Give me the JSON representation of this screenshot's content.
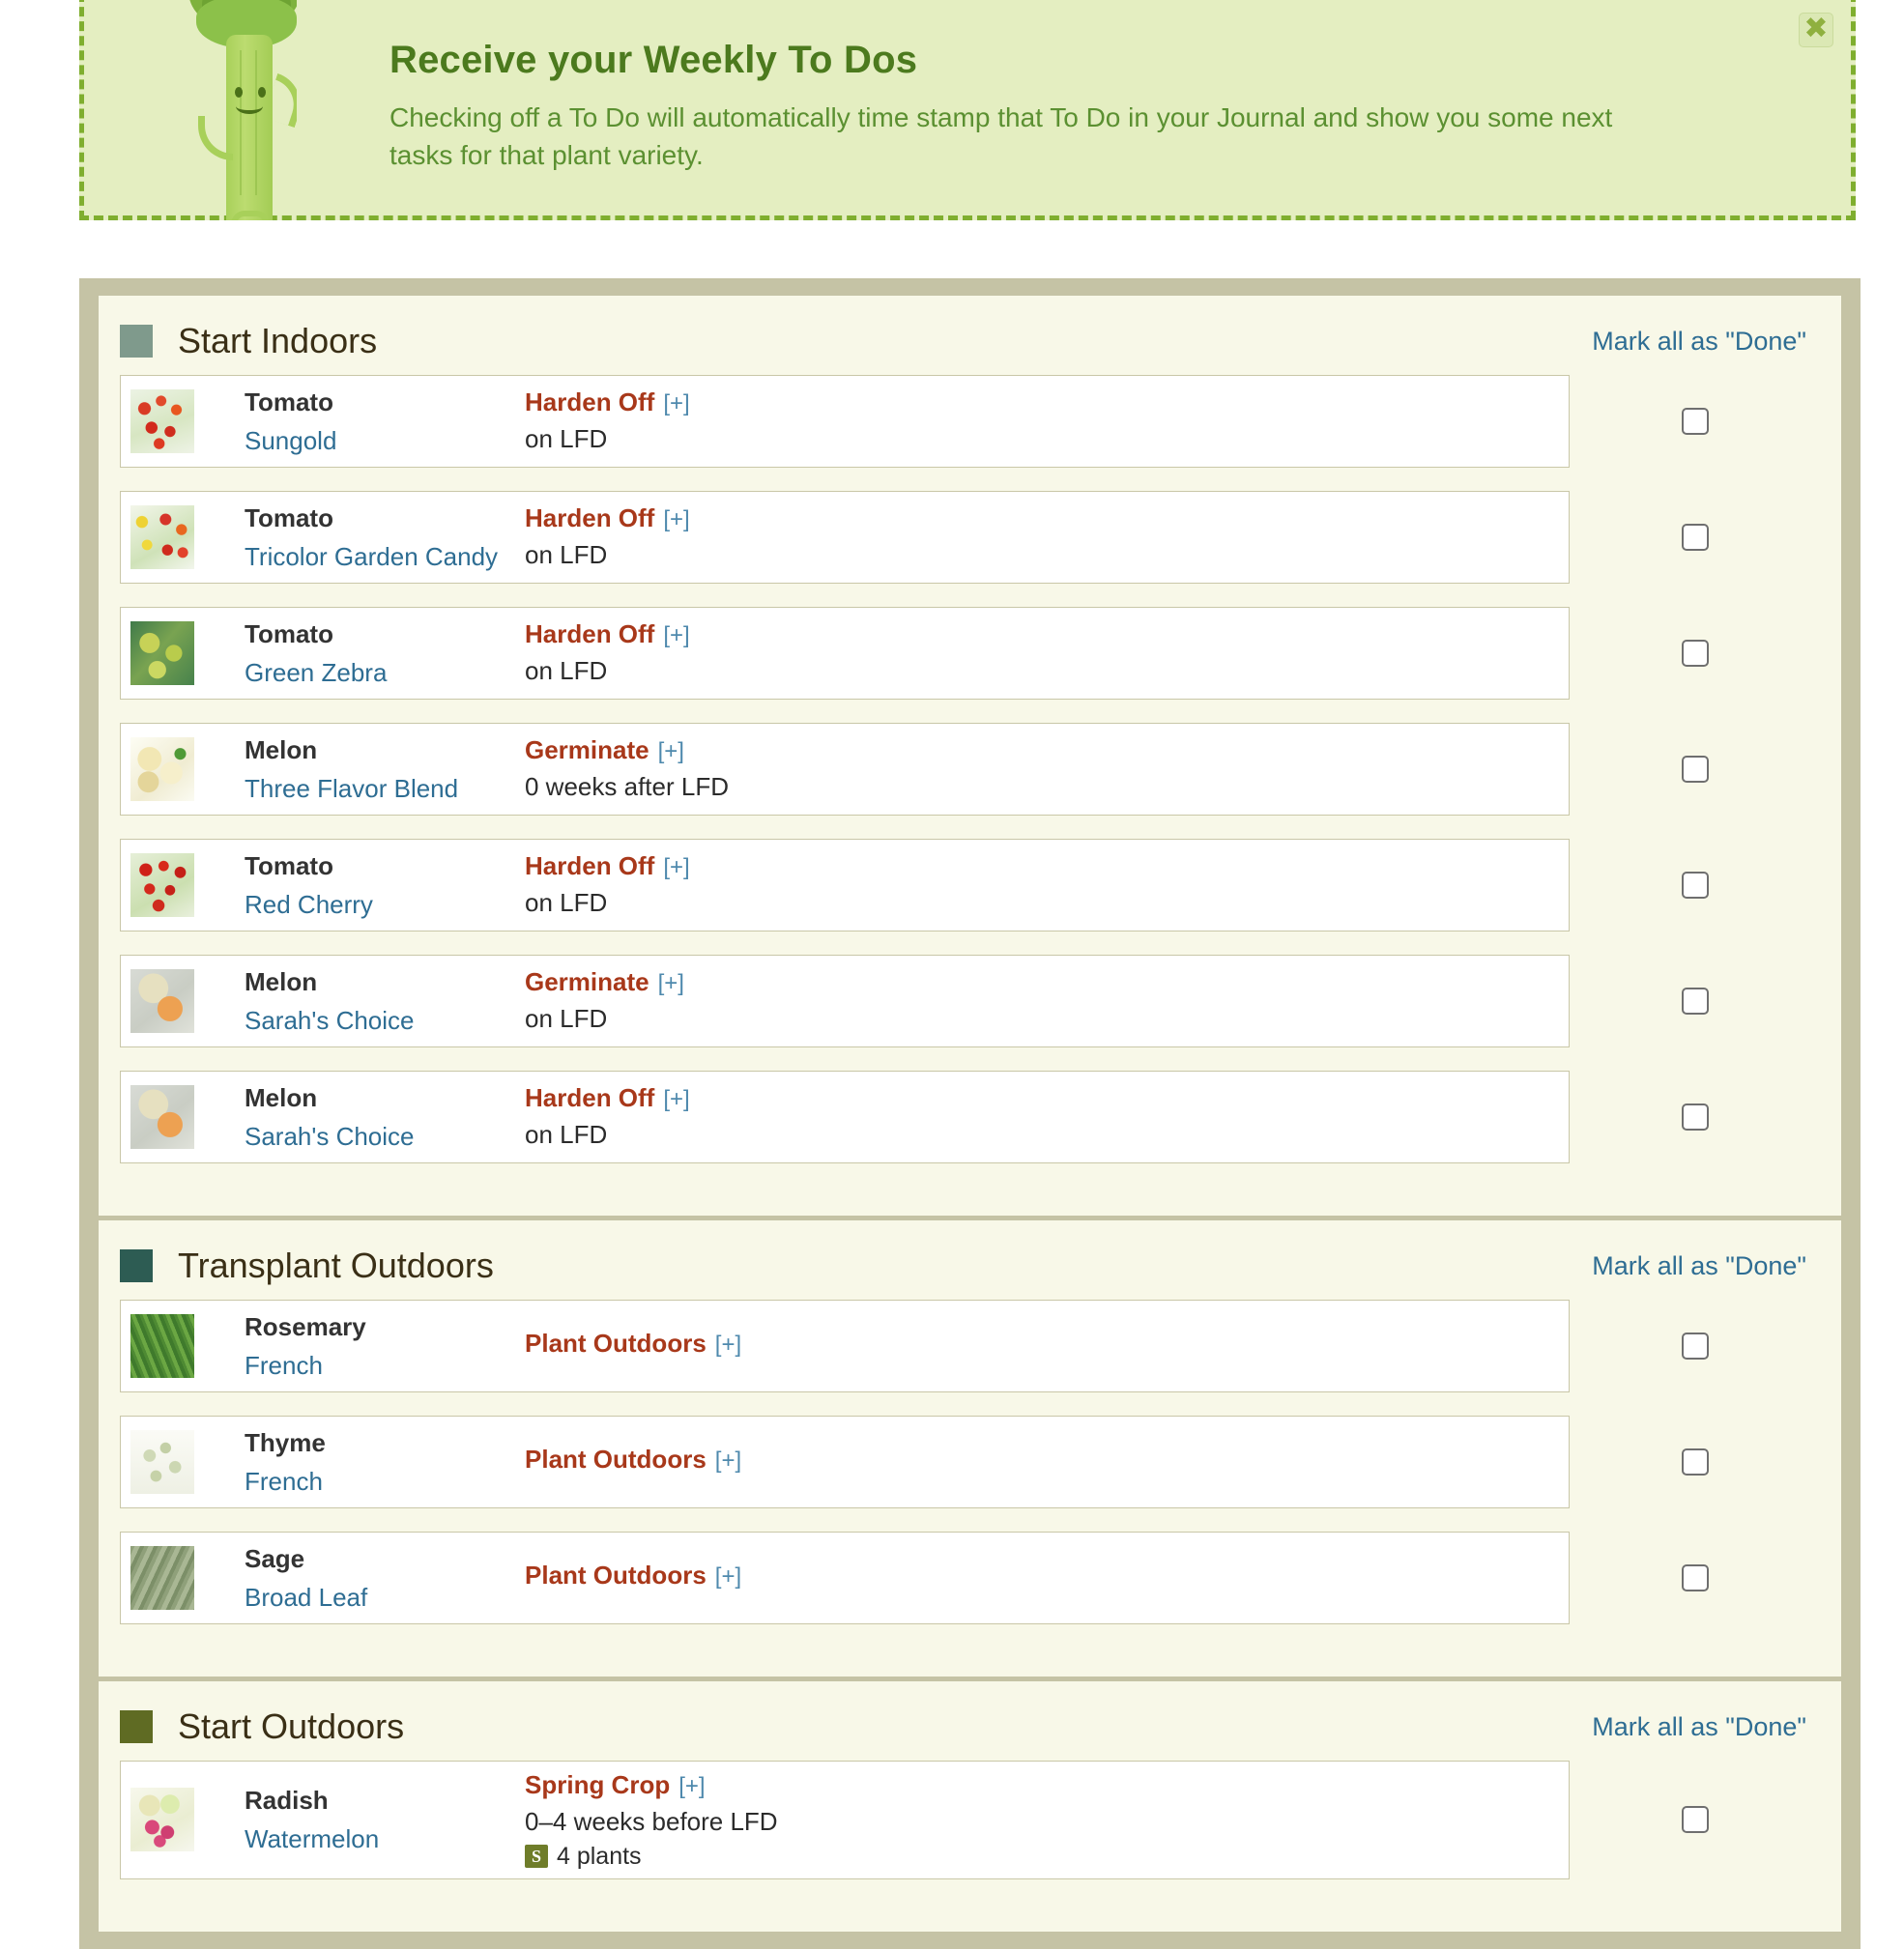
{
  "promo": {
    "title": "Receive your Weekly To Dos",
    "body": "Checking off a To Do will automatically time stamp that To Do in your Journal and show you some next tasks for that plant variety.",
    "close_label": "✖",
    "mascot_icon": "celery-mascot-icon",
    "bg_color": "#e4eec1",
    "border_color": "#7fae2f",
    "title_color": "#4c7a1e",
    "body_color": "#5b9031"
  },
  "colors": {
    "container_border": "#c5c3a5",
    "section_bg": "#f8f8e8",
    "row_bg": "#ffffff",
    "row_border": "#c9c7a8",
    "link": "#2e6d93",
    "task": "#a8381a",
    "plus": "#4e89ad"
  },
  "mark_all_label": "Mark all as \"Done\"",
  "sections": [
    {
      "title": "Start Indoors",
      "swatch_color": "#7f9a8c",
      "mark_all_label": "Mark all as \"Done\"",
      "rows": [
        {
          "thumb": "th-sungold",
          "thumb_name": "sungold-tomato-thumbnail",
          "plant": "Tomato",
          "variety": "Sungold",
          "task": "Harden Off",
          "plus": "[+]",
          "when": "on LFD",
          "qty": "",
          "qty_badge": "",
          "checked": false
        },
        {
          "thumb": "th-tricolor",
          "thumb_name": "tricolor-garden-candy-tomato-thumbnail",
          "plant": "Tomato",
          "variety": "Tricolor Garden Candy",
          "task": "Harden Off",
          "plus": "[+]",
          "when": "on LFD",
          "qty": "",
          "qty_badge": "",
          "checked": false
        },
        {
          "thumb": "th-greenzebra",
          "thumb_name": "green-zebra-tomato-thumbnail",
          "plant": "Tomato",
          "variety": "Green Zebra",
          "task": "Harden Off",
          "plus": "[+]",
          "when": "on LFD",
          "qty": "",
          "qty_badge": "",
          "checked": false
        },
        {
          "thumb": "th-threeflavor",
          "thumb_name": "three-flavor-blend-melon-thumbnail",
          "plant": "Melon",
          "variety": "Three Flavor Blend",
          "task": "Germinate",
          "plus": "[+]",
          "when": "0 weeks after LFD",
          "qty": "",
          "qty_badge": "",
          "checked": false
        },
        {
          "thumb": "th-redcherry",
          "thumb_name": "red-cherry-tomato-thumbnail",
          "plant": "Tomato",
          "variety": "Red Cherry",
          "task": "Harden Off",
          "plus": "[+]",
          "when": "on LFD",
          "qty": "",
          "qty_badge": "",
          "checked": false
        },
        {
          "thumb": "th-sarah",
          "thumb_name": "sarahs-choice-melon-thumbnail",
          "plant": "Melon",
          "variety": "Sarah's Choice",
          "task": "Germinate",
          "plus": "[+]",
          "when": "on LFD",
          "qty": "",
          "qty_badge": "",
          "checked": false
        },
        {
          "thumb": "th-sarah",
          "thumb_name": "sarahs-choice-melon-thumbnail",
          "plant": "Melon",
          "variety": "Sarah's Choice",
          "task": "Harden Off",
          "plus": "[+]",
          "when": "on LFD",
          "qty": "",
          "qty_badge": "",
          "checked": false
        }
      ]
    },
    {
      "title": "Transplant Outdoors",
      "swatch_color": "#2d5c53",
      "mark_all_label": "Mark all as \"Done\"",
      "rows": [
        {
          "thumb": "th-rosemary",
          "thumb_name": "french-rosemary-thumbnail",
          "plant": "Rosemary",
          "variety": "French",
          "task": "Plant Outdoors",
          "plus": "[+]",
          "when": "",
          "qty": "",
          "qty_badge": "",
          "checked": false
        },
        {
          "thumb": "th-thyme",
          "thumb_name": "french-thyme-thumbnail",
          "plant": "Thyme",
          "variety": "French",
          "task": "Plant Outdoors",
          "plus": "[+]",
          "when": "",
          "qty": "",
          "qty_badge": "",
          "checked": false
        },
        {
          "thumb": "th-sage",
          "thumb_name": "broad-leaf-sage-thumbnail",
          "plant": "Sage",
          "variety": "Broad Leaf",
          "task": "Plant Outdoors",
          "plus": "[+]",
          "when": "",
          "qty": "",
          "qty_badge": "",
          "checked": false
        }
      ]
    },
    {
      "title": "Start Outdoors",
      "swatch_color": "#5f6b23",
      "mark_all_label": "Mark all as \"Done\"",
      "rows": [
        {
          "thumb": "th-radish",
          "thumb_name": "watermelon-radish-thumbnail",
          "plant": "Radish",
          "variety": "Watermelon",
          "task": "Spring Crop",
          "plus": "[+]",
          "when": "0–4 weeks before LFD",
          "qty": "4 plants",
          "qty_badge": "S",
          "checked": false
        }
      ]
    }
  ]
}
